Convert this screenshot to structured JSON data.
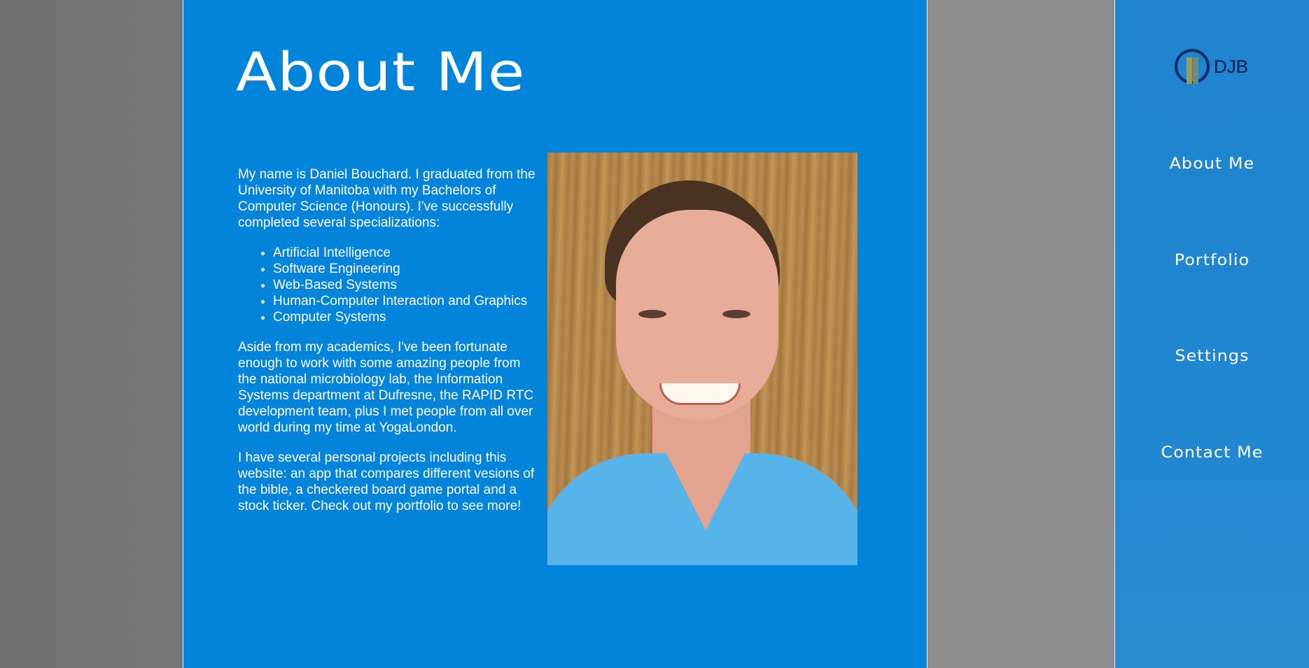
{
  "main": {
    "title": "About Me",
    "bio": {
      "intro": "My name is Daniel Bouchard. I graduated from the University of Manitoba with my Bachelors of Computer Science (Honours). I've successfully completed several specializations:",
      "specializations": [
        "Artificial Intelligence",
        "Software Engineering",
        "Web-Based Systems",
        "Human-Computer Interaction and Graphics",
        "Computer Systems"
      ],
      "work": "Aside from my academics, I've been fortunate enough to work with some amazing people from the national microbiology lab, the Information Systems department at Dufresne, the RAPID RTC development team, plus I met people from all over world during my time at YogaLondon.",
      "projects": "I have several personal projects including this website: an app that compares different vesions of the bible, a checkered board game portal and a stock ticker. Check out my portfolio to see more!"
    }
  },
  "sidebar": {
    "logo_text": "DJB",
    "items": [
      {
        "label": "About Me"
      },
      {
        "label": "Portfolio"
      },
      {
        "label": "Settings"
      },
      {
        "label": "Contact Me"
      }
    ]
  },
  "colors": {
    "main_panel": "#0384db",
    "sidebar": "#1f86cf",
    "background": "#808080",
    "text": "#ffffff",
    "logo_text": "#0c1f4f"
  }
}
